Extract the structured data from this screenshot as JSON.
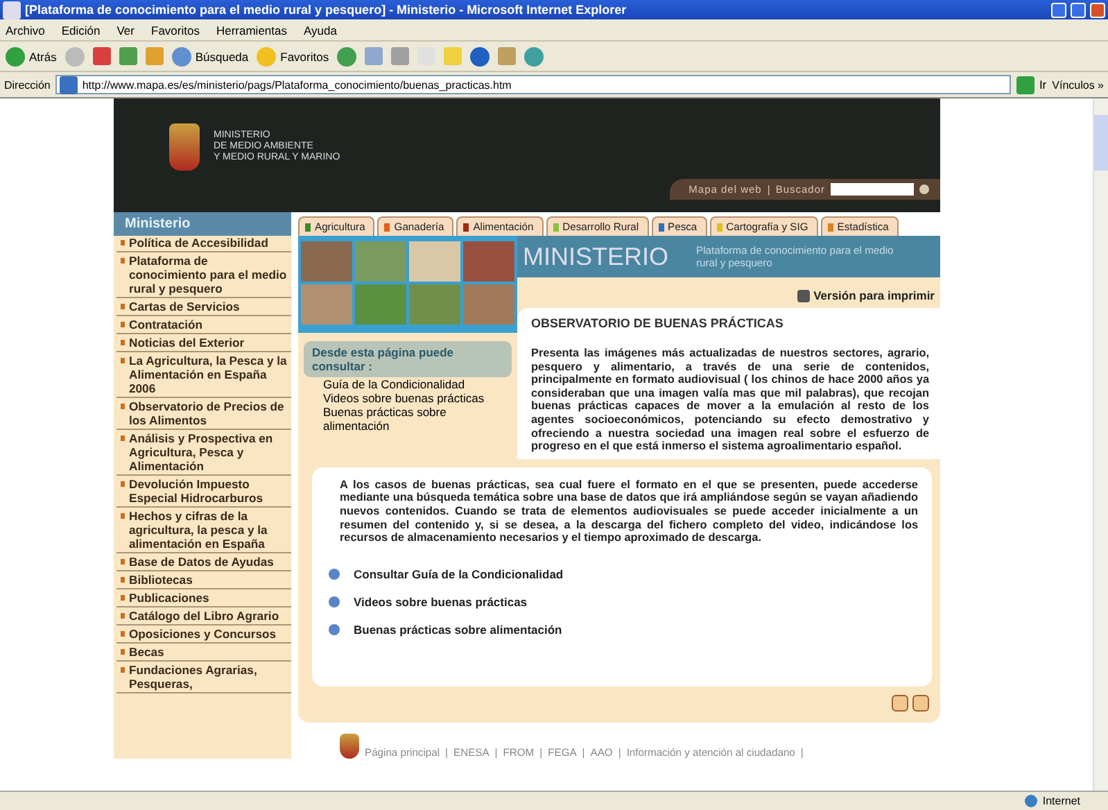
{
  "window": {
    "title": "[Plataforma de conocimiento para el medio rural y pesquero] - Ministerio - Microsoft Internet Explorer"
  },
  "menu": [
    "Archivo",
    "Edición",
    "Ver",
    "Favoritos",
    "Herramientas",
    "Ayuda"
  ],
  "toolbar": {
    "back": "Atrás",
    "search": "Búsqueda",
    "favorites": "Favoritos"
  },
  "address": {
    "label": "Dirección",
    "url": "http://www.mapa.es/es/ministerio/pags/Plataforma_conocimiento/buenas_practicas.htm",
    "go": "Ir",
    "links": "Vínculos »"
  },
  "header": {
    "org": [
      "MINISTERIO",
      "DE MEDIO AMBIENTE",
      "Y MEDIO RURAL Y MARINO"
    ],
    "site_map": "Mapa del web",
    "separator": "|",
    "search_label": "Buscador"
  },
  "sidebar": {
    "title": "Ministerio",
    "items": [
      {
        "label": "Política de Accesibilidad"
      },
      {
        "label": "Plataforma de conocimiento para el medio rural y pesquero"
      },
      {
        "label": "Cartas de Servicios"
      },
      {
        "label": "Contratación"
      },
      {
        "label": "Noticias del Exterior"
      },
      {
        "label": "La Agricultura, la Pesca y la Alimentación en España 2006"
      },
      {
        "label": "Observatorio de Precios de los Alimentos"
      },
      {
        "label": "Análisis y Prospectiva en Agricultura, Pesca y Alimentación"
      },
      {
        "label": "Devolución Impuesto Especial Hidrocarburos"
      },
      {
        "label": "Hechos y cifras de la agricultura, la pesca y la alimentación en España"
      },
      {
        "label": "Base de Datos de Ayudas"
      },
      {
        "label": "Bibliotecas"
      },
      {
        "label": "Publicaciones"
      },
      {
        "label": "Catálogo del Libro Agrario"
      },
      {
        "label": "Oposiciones y Concursos"
      },
      {
        "label": "Becas"
      },
      {
        "label": "Fundaciones Agrarias, Pesqueras,"
      }
    ]
  },
  "tabs": [
    {
      "label": "Agricultura",
      "color": "#3a8a2a"
    },
    {
      "label": "Ganadería",
      "color": "#e0601a"
    },
    {
      "label": "Alimentación",
      "color": "#a02a10"
    },
    {
      "label": "Desarrollo Rural",
      "color": "#8ac040"
    },
    {
      "label": "Pesca",
      "color": "#3070c0"
    },
    {
      "label": "Cartografía y SIG",
      "color": "#e0c020"
    },
    {
      "label": "Estadística",
      "color": "#e08020"
    }
  ],
  "banner": {
    "title": "MINISTERIO",
    "subtitle": "Plataforma de conocimiento para el medio rural y pesquero"
  },
  "print_link": "Versión para imprimir",
  "consult_box": {
    "title": "Desde esta página puede consultar :",
    "items": [
      "Guía de la Condicionalidad",
      "Videos sobre buenas prácticas",
      "Buenas prácticas sobre alimentación"
    ]
  },
  "heading": "OBSERVATORIO DE BUENAS PRÁCTICAS",
  "intro": "Presenta las imágenes más actualizadas de nuestros sectores, agrario, pesquero y alimentario, a través de una serie de contenidos, principalmente en formato audiovisual ( los chinos de hace 2000 años ya consideraban que una imagen valía mas que mil palabras), que recojan buenas prácticas capaces de mover a la emulación al resto de los agentes socioeconómicos, potenciando su efecto demostrativo y ofreciendo a nuestra sociedad una imagen real sobre el esfuerzo de progreso en el que está inmerso el sistema agroalimentario español.",
  "body": "A los casos de buenas prácticas, sea cual fuere el formato en el que se presenten, puede accederse mediante una búsqueda temática sobre una base de datos que irá ampliándose según se vayan añadiendo nuevos contenidos. Cuando se trata de elementos audiovisuales se puede acceder inicialmente a un resumen del contenido y, si se desea, a la descarga del fichero completo del video, indicándose los recursos de almacenamiento necesarios y el tiempo aproximado de descarga.",
  "links": [
    "Consultar Guía de la Condicionalidad",
    "Videos sobre buenas prácticas",
    "Buenas prácticas sobre alimentación"
  ],
  "footer": {
    "links": [
      "Página principal",
      "ENESA",
      "FROM",
      "FEGA",
      "AAO",
      "Información y atención al ciudadano"
    ],
    "separator": "|"
  },
  "status_bar": {
    "zone": "Internet"
  }
}
